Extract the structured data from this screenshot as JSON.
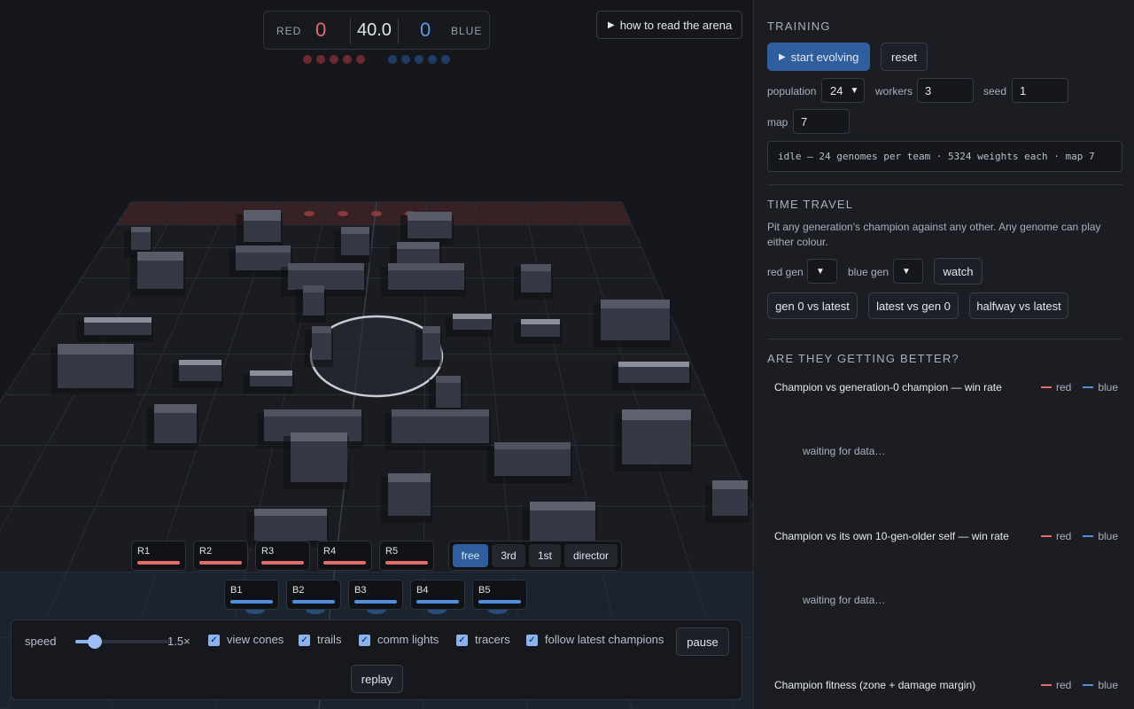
{
  "scoreboard": {
    "red_label": "RED",
    "red_score": "0",
    "time": "40.0",
    "blue_score": "0",
    "blue_label": "BLUE"
  },
  "how_to_button": "how to read the arena",
  "red_agents": [
    "R1",
    "R2",
    "R3",
    "R4",
    "R5"
  ],
  "blue_agents": [
    "B1",
    "B2",
    "B3",
    "B4",
    "B5"
  ],
  "camera_modes": [
    {
      "label": "free",
      "active": true
    },
    {
      "label": "3rd",
      "active": false
    },
    {
      "label": "1st",
      "active": false
    },
    {
      "label": "director",
      "active": false
    }
  ],
  "controls": {
    "speed_label": "speed",
    "speed_value": "1.5×",
    "speed_fraction": 0.2,
    "checkboxes": [
      "view cones",
      "trails",
      "comm lights",
      "tracers",
      "follow latest champions"
    ],
    "pause_label": "pause",
    "replay_label": "replay"
  },
  "training": {
    "title": "TRAINING",
    "start_label": "start evolving",
    "reset_label": "reset",
    "population_label": "population",
    "population_value": "24",
    "workers_label": "workers",
    "workers_value": "3",
    "seed_label": "seed",
    "seed_value": "1",
    "map_label": "map",
    "map_value": "7",
    "status": "idle — 24 genomes per team · 5324 weights each · map 7"
  },
  "time_travel": {
    "title": "TIME TRAVEL",
    "description": "Pit any generation's champion against any other. Any genome can play either colour.",
    "red_gen_label": "red gen",
    "blue_gen_label": "blue gen",
    "watch_label": "watch",
    "presets": [
      "gen 0 vs latest",
      "latest vs gen 0",
      "halfway vs latest"
    ]
  },
  "progress": {
    "title": "ARE THEY GETTING BETTER?",
    "legend_red": "red",
    "legend_blue": "blue",
    "waiting": "waiting for data…",
    "charts": [
      "Champion vs generation-0 champion — win rate",
      "Champion vs its own 10-gen-older self — win rate",
      "Champion fitness (zone + damage margin)"
    ]
  },
  "colors": {
    "red": "#e06c6c",
    "blue": "#4f8fe0",
    "accent": "#2f5e9e"
  }
}
